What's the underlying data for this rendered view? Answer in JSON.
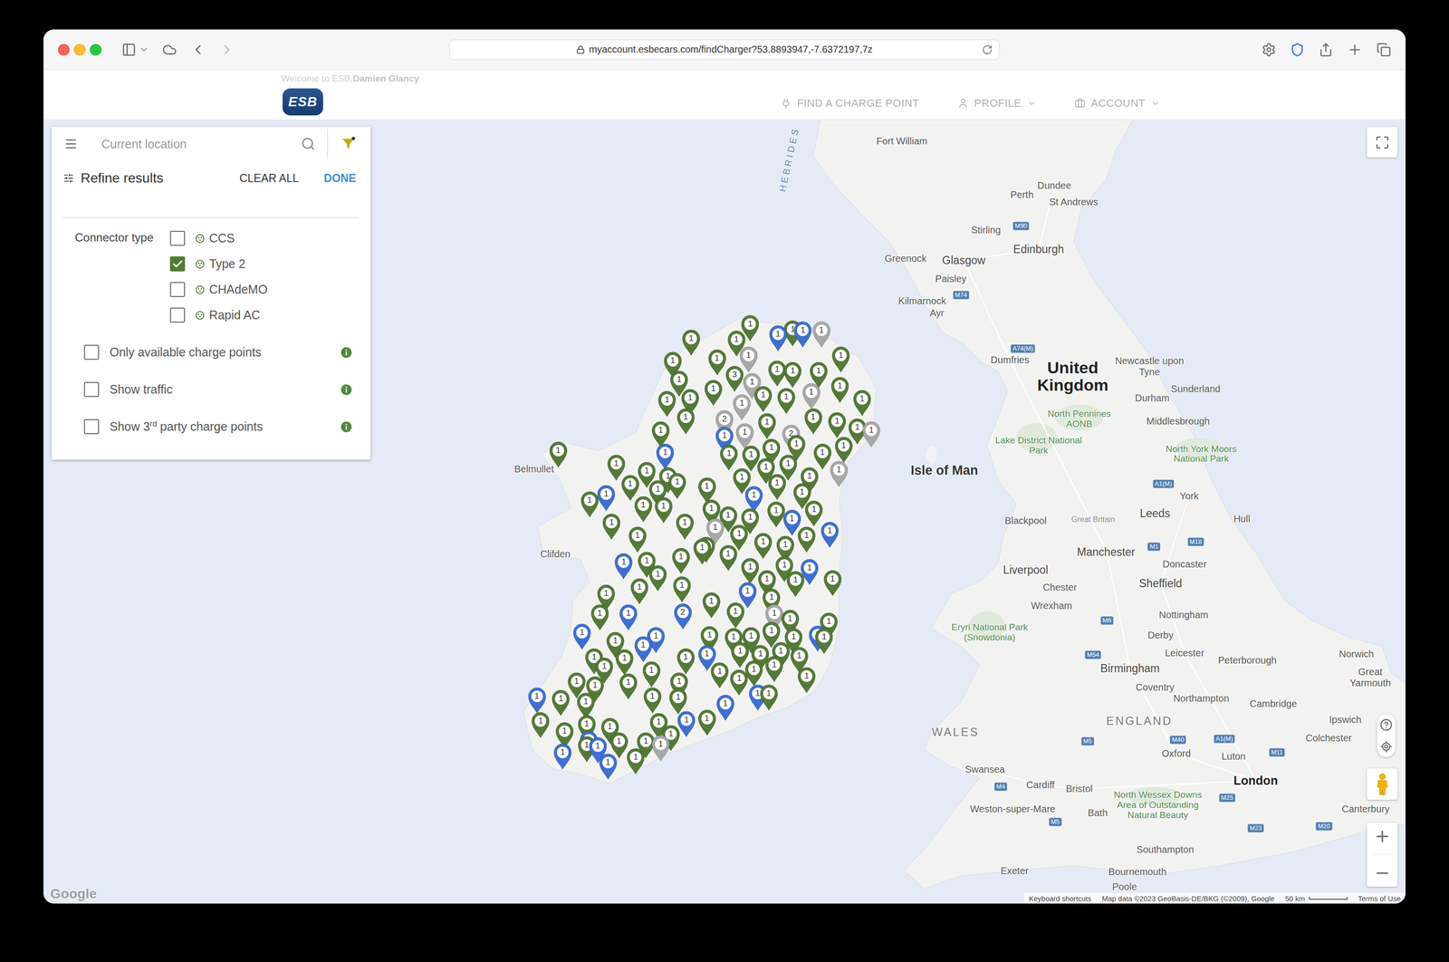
{
  "browser": {
    "url": "myaccount.esbecars.com/findCharger?53.8893947,-7.6372197,7z"
  },
  "header": {
    "welcome": "Welcome to ESB, ",
    "user": "Damien Glancy",
    "logo": "ESB",
    "nav": [
      {
        "label": "FIND A CHARGE POINT",
        "has_menu": false
      },
      {
        "label": "PROFILE",
        "has_menu": true
      },
      {
        "label": "ACCOUNT",
        "has_menu": true
      }
    ]
  },
  "search": {
    "placeholder": "Current location"
  },
  "filter": {
    "title": "Refine results",
    "clear": "CLEAR ALL",
    "done": "DONE",
    "connector_label": "Connector type",
    "connectors": [
      {
        "label": "CCS",
        "checked": false
      },
      {
        "label": "Type 2",
        "checked": true
      },
      {
        "label": "CHAdeMO",
        "checked": false
      },
      {
        "label": "Rapid AC",
        "checked": false
      }
    ],
    "options": [
      {
        "parts": [
          {
            "text": "Only available charge points",
            "sup": false
          }
        ],
        "checked": false
      },
      {
        "parts": [
          {
            "text": "Show traffic",
            "sup": false
          }
        ],
        "checked": false
      },
      {
        "parts": [
          {
            "text": "Show 3",
            "sup": false
          },
          {
            "text": "rd",
            "sup": true
          },
          {
            "text": " party charge points",
            "sup": false
          }
        ],
        "checked": false
      }
    ]
  },
  "map": {
    "labels": [
      {
        "text": "HEBRIDES",
        "kind": "water"
      },
      {
        "text": "Fort William",
        "kind": "city"
      },
      {
        "text": "Dundee",
        "kind": "city"
      },
      {
        "text": "Perth",
        "kind": "city"
      },
      {
        "text": "St Andrews",
        "kind": "city"
      },
      {
        "text": "Stirling",
        "kind": "city"
      },
      {
        "text": "Glasgow",
        "kind": "major"
      },
      {
        "text": "Edinburgh",
        "kind": "major"
      },
      {
        "text": "Greenock",
        "kind": "city"
      },
      {
        "text": "Paisley",
        "kind": "city"
      },
      {
        "text": "Kilmarnock",
        "kind": "city"
      },
      {
        "text": "Ayr",
        "kind": "city"
      },
      {
        "text": "Dumfries",
        "kind": "city"
      },
      {
        "text": "United Kingdom",
        "kind": "country"
      },
      {
        "text": "Newcastle upon Tyne",
        "kind": "city"
      },
      {
        "text": "Sunderland",
        "kind": "city"
      },
      {
        "text": "Durham",
        "kind": "city"
      },
      {
        "text": "North Pennines AONB",
        "kind": "park"
      },
      {
        "text": "Middlesbrough",
        "kind": "city"
      },
      {
        "text": "Lake District National Park",
        "kind": "park"
      },
      {
        "text": "North York Moors National Park",
        "kind": "park"
      },
      {
        "text": "Isle of Man",
        "kind": "island"
      },
      {
        "text": "York",
        "kind": "city"
      },
      {
        "text": "Leeds",
        "kind": "major"
      },
      {
        "text": "Hull",
        "kind": "city"
      },
      {
        "text": "Blackpool",
        "kind": "city"
      },
      {
        "text": "Great Britain",
        "kind": "small"
      },
      {
        "text": "Manchester",
        "kind": "major"
      },
      {
        "text": "Liverpool",
        "kind": "major"
      },
      {
        "text": "Doncaster",
        "kind": "city"
      },
      {
        "text": "Sheffield",
        "kind": "major"
      },
      {
        "text": "Chester",
        "kind": "city"
      },
      {
        "text": "Wrexham",
        "kind": "city"
      },
      {
        "text": "Eryri National Park (Snowdonia)",
        "kind": "park"
      },
      {
        "text": "Nottingham",
        "kind": "city"
      },
      {
        "text": "Derby",
        "kind": "city"
      },
      {
        "text": "Leicester",
        "kind": "city"
      },
      {
        "text": "Peterborough",
        "kind": "city"
      },
      {
        "text": "Norwich",
        "kind": "city"
      },
      {
        "text": "Great Yarmouth",
        "kind": "city"
      },
      {
        "text": "Birmingham",
        "kind": "major"
      },
      {
        "text": "Coventry",
        "kind": "city"
      },
      {
        "text": "Northampton",
        "kind": "city"
      },
      {
        "text": "Cambridge",
        "kind": "city"
      },
      {
        "text": "Ipswich",
        "kind": "city"
      },
      {
        "text": "Colchester",
        "kind": "city"
      },
      {
        "text": "WALES",
        "kind": "region"
      },
      {
        "text": "ENGLAND",
        "kind": "region"
      },
      {
        "text": "Oxford",
        "kind": "city"
      },
      {
        "text": "Luton",
        "kind": "city"
      },
      {
        "text": "Swansea",
        "kind": "city"
      },
      {
        "text": "Cardiff",
        "kind": "city"
      },
      {
        "text": "Bristol",
        "kind": "city"
      },
      {
        "text": "North Wessex Downs Area of Outstanding Natural Beauty",
        "kind": "park"
      },
      {
        "text": "London",
        "kind": "capital"
      },
      {
        "text": "Weston-super-Mare",
        "kind": "city"
      },
      {
        "text": "Bath",
        "kind": "city"
      },
      {
        "text": "Canterbury",
        "kind": "city"
      },
      {
        "text": "Southampton",
        "kind": "city"
      },
      {
        "text": "Exeter",
        "kind": "city"
      },
      {
        "text": "Bournemouth",
        "kind": "city"
      },
      {
        "text": "Poole",
        "kind": "city"
      },
      {
        "text": "Belmullet",
        "kind": "city"
      },
      {
        "text": "Clifden",
        "kind": "city"
      },
      {
        "text": "M90",
        "kind": "road"
      },
      {
        "text": "M74",
        "kind": "road"
      },
      {
        "text": "A74(M)",
        "kind": "road"
      },
      {
        "text": "A1(M)",
        "kind": "road"
      },
      {
        "text": "M1",
        "kind": "road"
      },
      {
        "text": "M18",
        "kind": "road"
      },
      {
        "text": "M6",
        "kind": "road"
      },
      {
        "text": "M54",
        "kind": "road"
      },
      {
        "text": "M5",
        "kind": "road"
      },
      {
        "text": "M40",
        "kind": "road"
      },
      {
        "text": "A1(M)",
        "kind": "road"
      },
      {
        "text": "M11",
        "kind": "road"
      },
      {
        "text": "M4",
        "kind": "road"
      },
      {
        "text": "M25",
        "kind": "road"
      },
      {
        "text": "M23",
        "kind": "road"
      },
      {
        "text": "M20",
        "kind": "road"
      },
      {
        "text": "M5",
        "kind": "road"
      }
    ],
    "pins": [
      {
        "label": "1",
        "color": "#537b35"
      },
      {
        "label": "1",
        "color": "#537b35"
      },
      {
        "label": "1",
        "color": "#537b35"
      },
      {
        "label": "1",
        "color": "#3d6fd6"
      },
      {
        "label": "1",
        "color": "#537b35"
      },
      {
        "label": "1",
        "color": "#3d6fd6"
      },
      {
        "label": "1",
        "color": "#a8a8a8"
      },
      {
        "label": "1",
        "color": "#537b35"
      },
      {
        "label": "1",
        "color": "#537b35"
      },
      {
        "label": "1",
        "color": "#a8a8a8"
      },
      {
        "label": "1",
        "color": "#537b35"
      },
      {
        "label": "3",
        "color": "#537b35"
      },
      {
        "label": "1",
        "color": "#a8a8a8"
      },
      {
        "label": "1",
        "color": "#537b35"
      },
      {
        "label": "1",
        "color": "#537b35"
      },
      {
        "label": "1",
        "color": "#537b35"
      },
      {
        "label": "1",
        "color": "#537b35"
      },
      {
        "label": "1",
        "color": "#537b35"
      },
      {
        "label": "1",
        "color": "#537b35"
      },
      {
        "label": "1",
        "color": "#537b35"
      },
      {
        "label": "1",
        "color": "#a8a8a8"
      },
      {
        "label": "1",
        "color": "#537b35"
      },
      {
        "label": "1",
        "color": "#537b35"
      },
      {
        "label": "1",
        "color": "#a8a8a8"
      },
      {
        "label": "1",
        "color": "#537b35"
      },
      {
        "label": "1",
        "color": "#537b35"
      },
      {
        "label": "2",
        "color": "#a8a8a8"
      },
      {
        "label": "1",
        "color": "#537b35"
      },
      {
        "label": "1",
        "color": "#a8a8a8"
      },
      {
        "label": "1",
        "color": "#537b35"
      },
      {
        "label": "2",
        "color": "#a8a8a8"
      },
      {
        "label": "1",
        "color": "#537b35"
      },
      {
        "label": "1",
        "color": "#537b35"
      },
      {
        "label": "1",
        "color": "#537b35"
      },
      {
        "label": "1",
        "color": "#a8a8a8"
      },
      {
        "label": "1",
        "color": "#537b35"
      },
      {
        "label": "1",
        "color": "#3d6fd6"
      },
      {
        "label": "1",
        "color": "#3d6fd6"
      },
      {
        "label": "1",
        "color": "#537b35"
      },
      {
        "label": "1",
        "color": "#537b35"
      },
      {
        "label": "1",
        "color": "#537b35"
      },
      {
        "label": "1",
        "color": "#537b35"
      },
      {
        "label": "1",
        "color": "#537b35"
      },
      {
        "label": "1",
        "color": "#537b35"
      },
      {
        "label": "1",
        "color": "#537b35"
      },
      {
        "label": "1",
        "color": "#537b35"
      },
      {
        "label": "1",
        "color": "#537b35"
      },
      {
        "label": "1",
        "color": "#537b35"
      },
      {
        "label": "1",
        "color": "#537b35"
      },
      {
        "label": "1",
        "color": "#537b35"
      },
      {
        "label": "1",
        "color": "#537b35"
      },
      {
        "label": "1",
        "color": "#537b35"
      },
      {
        "label": "1",
        "color": "#a8a8a8"
      },
      {
        "label": "1",
        "color": "#537b35"
      },
      {
        "label": "1",
        "color": "#3d6fd6"
      },
      {
        "label": "1",
        "color": "#537b35"
      },
      {
        "label": "1",
        "color": "#537b35"
      },
      {
        "label": "1",
        "color": "#537b35"
      },
      {
        "label": "1",
        "color": "#537b35"
      },
      {
        "label": "1",
        "color": "#3d6fd6"
      },
      {
        "label": "1",
        "color": "#537b35"
      },
      {
        "label": "1",
        "color": "#537b35"
      },
      {
        "label": "1",
        "color": "#537b35"
      },
      {
        "label": "1",
        "color": "#537b35"
      },
      {
        "label": "1",
        "color": "#537b35"
      },
      {
        "label": "1",
        "color": "#537b35"
      },
      {
        "label": "1",
        "color": "#537b35"
      },
      {
        "label": "1",
        "color": "#537b35"
      },
      {
        "label": "1",
        "color": "#537b35"
      },
      {
        "label": "1",
        "color": "#537b35"
      },
      {
        "label": "1",
        "color": "#3d6fd6"
      },
      {
        "label": "1",
        "color": "#537b35"
      },
      {
        "label": "1",
        "color": "#3d6fd6"
      },
      {
        "label": "1",
        "color": "#537b35"
      },
      {
        "label": "1",
        "color": "#537b35"
      },
      {
        "label": "1",
        "color": "#a8a8a8"
      },
      {
        "label": "1",
        "color": "#537b35"
      },
      {
        "label": "1",
        "color": "#537b35"
      },
      {
        "label": "1",
        "color": "#537b35"
      },
      {
        "label": "1",
        "color": "#537b35"
      },
      {
        "label": "1",
        "color": "#3d6fd6"
      },
      {
        "label": "1",
        "color": "#537b35"
      },
      {
        "label": "1",
        "color": "#537b35"
      },
      {
        "label": "1",
        "color": "#537b35"
      },
      {
        "label": "1",
        "color": "#537b35"
      },
      {
        "label": "1",
        "color": "#537b35"
      },
      {
        "label": "1",
        "color": "#537b35"
      },
      {
        "label": "1",
        "color": "#3d6fd6"
      },
      {
        "label": "1",
        "color": "#537b35"
      },
      {
        "label": "1",
        "color": "#537b35"
      },
      {
        "label": "1",
        "color": "#537b35"
      },
      {
        "label": "1",
        "color": "#537b35"
      },
      {
        "label": "1",
        "color": "#537b35"
      },
      {
        "label": "1",
        "color": "#537b35"
      },
      {
        "label": "1",
        "color": "#3d6fd6"
      },
      {
        "label": "1",
        "color": "#537b35"
      },
      {
        "label": "1",
        "color": "#537b35"
      },
      {
        "label": "1",
        "color": "#537b35"
      },
      {
        "label": "1",
        "color": "#3d6fd6"
      },
      {
        "label": "2",
        "color": "#3d6fd6"
      },
      {
        "label": "1",
        "color": "#537b35"
      },
      {
        "label": "1",
        "color": "#537b35"
      },
      {
        "label": "1",
        "color": "#a8a8a8"
      },
      {
        "label": "1",
        "color": "#537b35"
      },
      {
        "label": "1",
        "color": "#537b35"
      },
      {
        "label": "1",
        "color": "#3d6fd6"
      },
      {
        "label": "1",
        "color": "#537b35"
      },
      {
        "label": "1",
        "color": "#3d6fd6"
      },
      {
        "label": "1",
        "color": "#537b35"
      },
      {
        "label": "1",
        "color": "#537b35"
      },
      {
        "label": "1",
        "color": "#3d6fd6"
      },
      {
        "label": "1",
        "color": "#537b35"
      },
      {
        "label": "1",
        "color": "#537b35"
      },
      {
        "label": "1",
        "color": "#537b35"
      },
      {
        "label": "1",
        "color": "#537b35"
      },
      {
        "label": "1",
        "color": "#537b35"
      },
      {
        "label": "1",
        "color": "#3d6fd6"
      },
      {
        "label": "1",
        "color": "#537b35"
      },
      {
        "label": "1",
        "color": "#537b35"
      },
      {
        "label": "1",
        "color": "#537b35"
      },
      {
        "label": "1",
        "color": "#537b35"
      },
      {
        "label": "1",
        "color": "#3d6fd6"
      },
      {
        "label": "1",
        "color": "#537b35"
      },
      {
        "label": "1",
        "color": "#537b35"
      },
      {
        "label": "1",
        "color": "#537b35"
      },
      {
        "label": "1",
        "color": "#537b35"
      },
      {
        "label": "1",
        "color": "#537b35"
      },
      {
        "label": "1",
        "color": "#537b35"
      },
      {
        "label": "1",
        "color": "#537b35"
      },
      {
        "label": "1",
        "color": "#537b35"
      },
      {
        "label": "1",
        "color": "#537b35"
      },
      {
        "label": "1",
        "color": "#537b35"
      },
      {
        "label": "1",
        "color": "#537b35"
      },
      {
        "label": "1",
        "color": "#537b35"
      },
      {
        "label": "1",
        "color": "#3d6fd6"
      },
      {
        "label": "1",
        "color": "#537b35"
      },
      {
        "label": "1",
        "color": "#537b35"
      },
      {
        "label": "1",
        "color": "#537b35"
      },
      {
        "label": "1",
        "color": "#537b35"
      },
      {
        "label": "1",
        "color": "#537b35"
      },
      {
        "label": "1",
        "color": "#3d6fd6"
      },
      {
        "label": "1",
        "color": "#537b35"
      },
      {
        "label": "1",
        "color": "#537b35"
      },
      {
        "label": "1",
        "color": "#537b35"
      },
      {
        "label": "1",
        "color": "#537b35"
      },
      {
        "label": "1",
        "color": "#537b35"
      },
      {
        "label": "1",
        "color": "#3d6fd6"
      },
      {
        "label": "1",
        "color": "#537b35"
      },
      {
        "label": "1",
        "color": "#3d6fd6"
      },
      {
        "label": "1",
        "color": "#537b35"
      },
      {
        "label": "1",
        "color": "#3d6fd6"
      },
      {
        "label": "1",
        "color": "#3d6fd6"
      },
      {
        "label": "1",
        "color": "#537b35"
      },
      {
        "label": "1",
        "color": "#537b35"
      },
      {
        "label": "1",
        "color": "#537b35"
      },
      {
        "label": "1",
        "color": "#a8a8a8"
      },
      {
        "label": "1",
        "color": "#3d6fd6"
      },
      {
        "label": "1",
        "color": "#3d6fd6"
      },
      {
        "label": "1",
        "color": "#537b35"
      },
      {
        "label": "1",
        "color": "#537b35"
      }
    ],
    "google": "Google",
    "footer": [
      "Keyboard shortcuts",
      "Map data ©2023 GeoBasis-DE/BKG (©2009), Google"
    ],
    "scale": "50 km",
    "terms": "Terms of Use"
  }
}
